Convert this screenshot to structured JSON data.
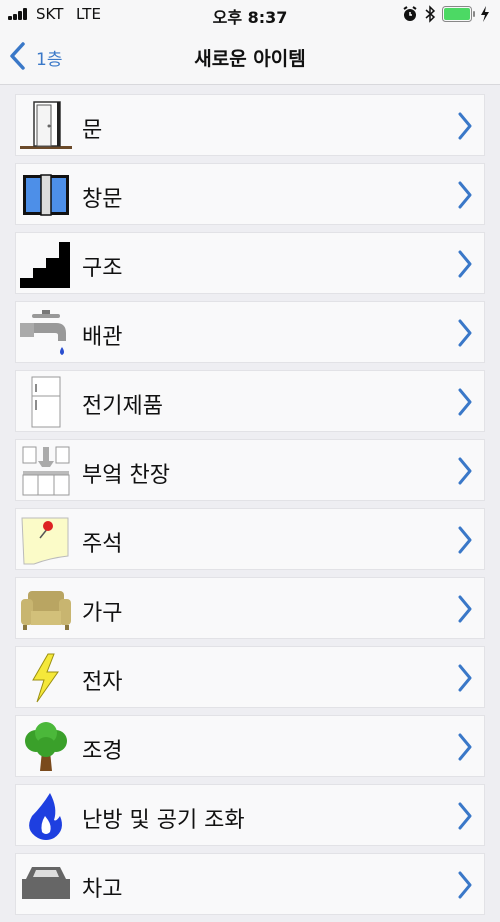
{
  "status_bar": {
    "carrier": "SKT",
    "network": "LTE",
    "time": "오후 8:37"
  },
  "nav": {
    "back_label": "1층",
    "title": "새로운 아이템"
  },
  "items": [
    {
      "label": "문",
      "icon": "door-icon"
    },
    {
      "label": "창문",
      "icon": "window-icon"
    },
    {
      "label": "구조",
      "icon": "stairs-icon"
    },
    {
      "label": "배관",
      "icon": "faucet-icon"
    },
    {
      "label": "전기제품",
      "icon": "refrigerator-icon"
    },
    {
      "label": "부엌 찬장",
      "icon": "kitchen-cabinet-icon"
    },
    {
      "label": "주석",
      "icon": "sticky-note-icon"
    },
    {
      "label": "가구",
      "icon": "sofa-icon"
    },
    {
      "label": "전자",
      "icon": "lightning-icon"
    },
    {
      "label": "조경",
      "icon": "tree-icon"
    },
    {
      "label": "난방 및 공기 조화",
      "icon": "flame-icon"
    },
    {
      "label": "차고",
      "icon": "car-icon"
    }
  ],
  "colors": {
    "accent": "#3a78c8",
    "battery": "#4cd964"
  }
}
